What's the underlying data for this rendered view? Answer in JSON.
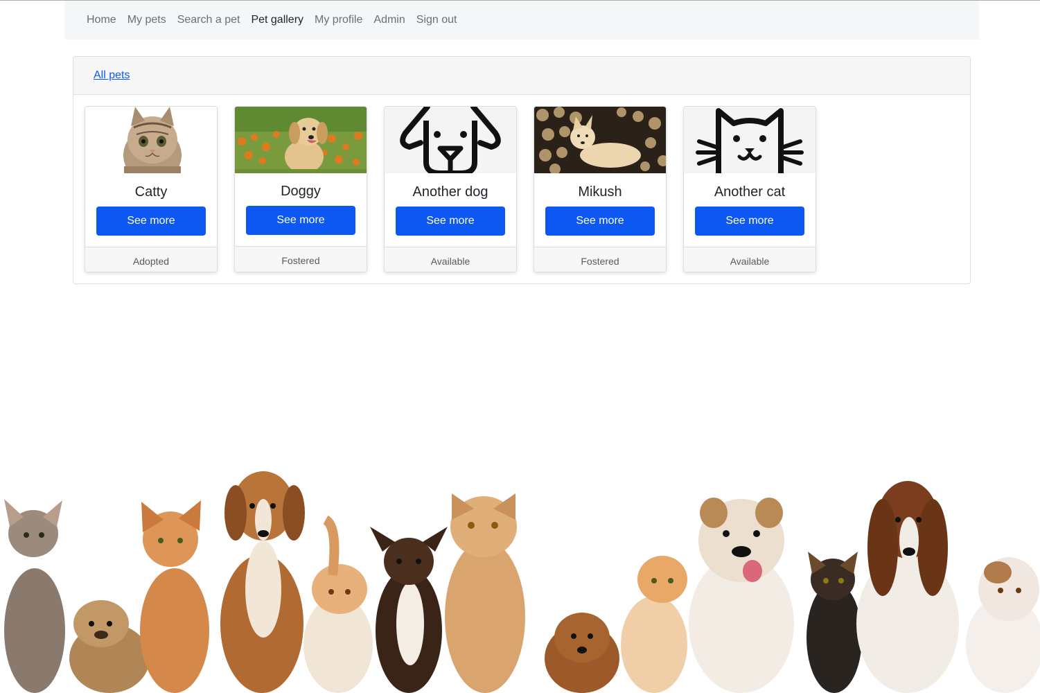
{
  "nav": {
    "items": [
      {
        "label": "Home",
        "active": false
      },
      {
        "label": "My pets",
        "active": false
      },
      {
        "label": "Search a pet",
        "active": false
      },
      {
        "label": "Pet gallery",
        "active": true
      },
      {
        "label": "My profile",
        "active": false
      },
      {
        "label": "Admin",
        "active": false
      },
      {
        "label": "Sign out",
        "active": false
      }
    ]
  },
  "gallery": {
    "header_link": "All pets",
    "cards": [
      {
        "name": "Catty",
        "button": "See more",
        "status": "Adopted",
        "image": "cat-photo"
      },
      {
        "name": "Doggy",
        "button": "See more",
        "status": "Fostered",
        "image": "puppy-photo"
      },
      {
        "name": "Another dog",
        "button": "See more",
        "status": "Available",
        "image": "dog-outline-icon"
      },
      {
        "name": "Mikush",
        "button": "See more",
        "status": "Fostered",
        "image": "dog-photo"
      },
      {
        "name": "Another cat",
        "button": "See more",
        "status": "Available",
        "image": "cat-outline-icon"
      }
    ]
  },
  "colors": {
    "accent": "#0d58f2",
    "navbar_bg": "#f5f6f7",
    "panel_header_bg": "#f7f7f7"
  },
  "banner": {
    "image": "cats-and-dogs-lineup-photo"
  }
}
